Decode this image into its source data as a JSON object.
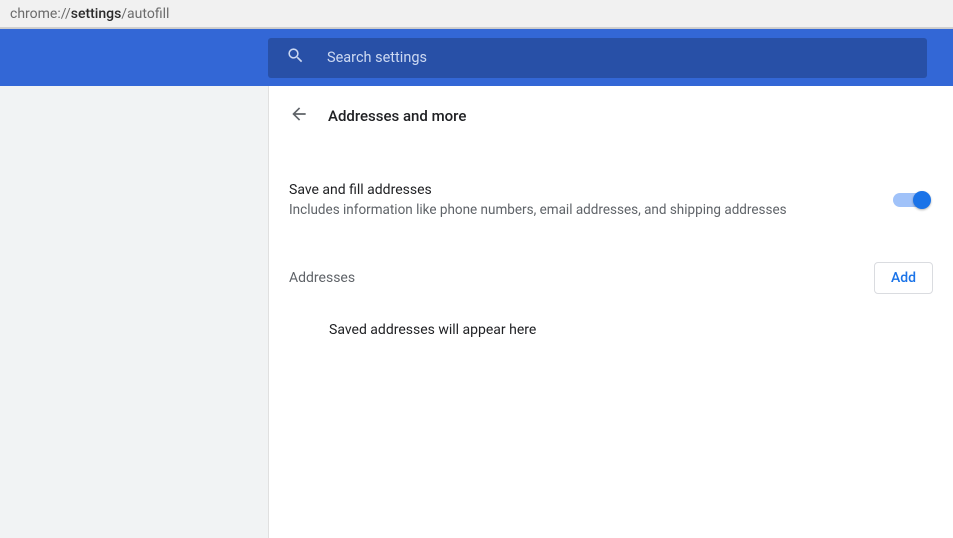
{
  "address_bar": {
    "prefix": "chrome://",
    "bold": "settings",
    "suffix": "/autofill"
  },
  "search": {
    "placeholder": "Search settings"
  },
  "page": {
    "title": "Addresses and more"
  },
  "save_fill": {
    "title": "Save and fill addresses",
    "subtitle": "Includes information like phone numbers, email addresses, and shipping addresses",
    "enabled": true
  },
  "addresses_section": {
    "label": "Addresses",
    "add_label": "Add",
    "empty_text": "Saved addresses will appear here"
  }
}
